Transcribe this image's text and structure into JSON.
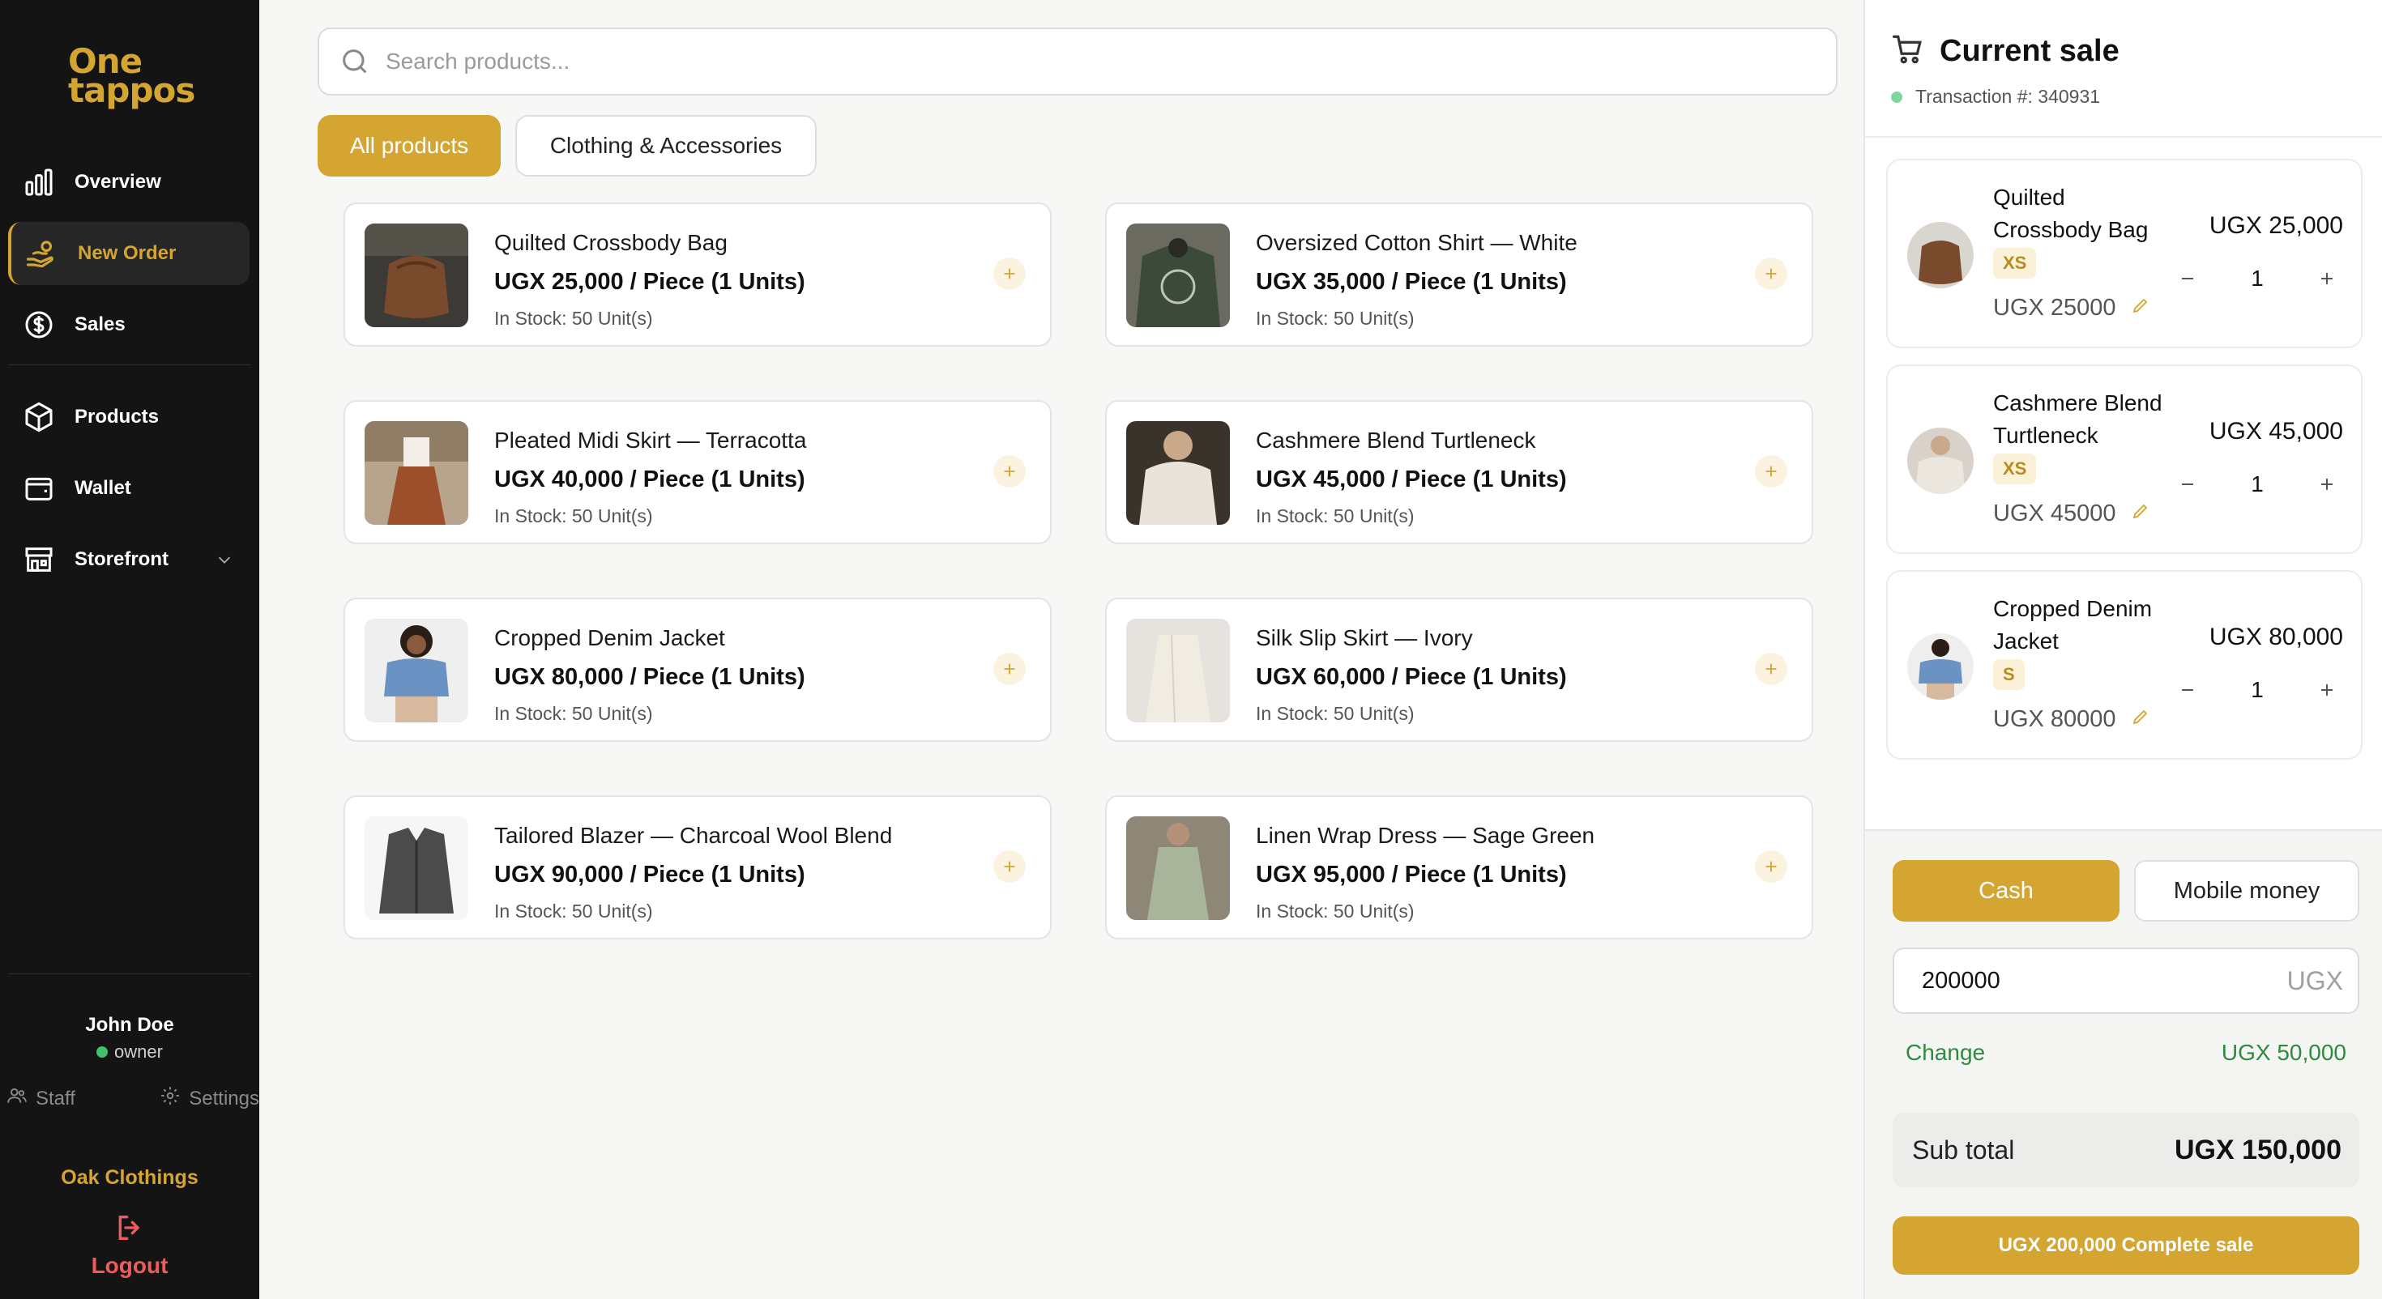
{
  "brand": {
    "logo_line1": "One",
    "logo_line2": "tappos",
    "accent": "#d4a531"
  },
  "sidebar": {
    "items": [
      {
        "label": "Overview",
        "icon": "bar-chart-icon"
      },
      {
        "label": "New Order",
        "icon": "hand-coins-icon",
        "active": true
      },
      {
        "label": "Sales",
        "icon": "dollar-circle-icon"
      },
      {
        "label": "Products",
        "icon": "box-icon"
      },
      {
        "label": "Wallet",
        "icon": "wallet-icon"
      },
      {
        "label": "Storefront",
        "icon": "store-icon"
      }
    ],
    "user": {
      "name": "John Doe",
      "role": "owner"
    },
    "staff_label": "Staff",
    "settings_label": "Settings",
    "store_name": "Oak Clothings",
    "logout_label": "Logout"
  },
  "search": {
    "placeholder": "Search products..."
  },
  "tabs": [
    {
      "label": "All products",
      "active": true
    },
    {
      "label": "Clothing & Accessories",
      "active": false
    }
  ],
  "products": [
    {
      "title": "Quilted Crossbody Bag",
      "price": "UGX 25,000 / Piece (1 Units)",
      "stock": "In Stock: 50 Unit(s)"
    },
    {
      "title": "Oversized Cotton Shirt — White",
      "price": "UGX 35,000 / Piece (1 Units)",
      "stock": "In Stock: 50 Unit(s)"
    },
    {
      "title": "Pleated Midi Skirt — Terracotta",
      "price": "UGX 40,000 / Piece (1 Units)",
      "stock": "In Stock: 50 Unit(s)"
    },
    {
      "title": "Cashmere Blend Turtleneck",
      "price": "UGX 45,000 / Piece (1 Units)",
      "stock": "In Stock: 50 Unit(s)"
    },
    {
      "title": "Cropped Denim Jacket",
      "price": "UGX 80,000 / Piece (1 Units)",
      "stock": "In Stock: 50 Unit(s)"
    },
    {
      "title": "Silk Slip Skirt — Ivory",
      "price": "UGX 60,000 / Piece (1 Units)",
      "stock": "In Stock: 50 Unit(s)"
    },
    {
      "title": "Tailored Blazer — Charcoal Wool Blend",
      "price": "UGX 90,000 / Piece (1 Units)",
      "stock": "In Stock: 50 Unit(s)"
    },
    {
      "title": "Linen Wrap Dress — Sage Green",
      "price": "UGX 95,000 / Piece (1 Units)",
      "stock": "In Stock: 50 Unit(s)"
    }
  ],
  "sale": {
    "title": "Current sale",
    "transaction": "Transaction #: 340931",
    "items": [
      {
        "name": "Quilted Crossbody Bag",
        "size": "XS",
        "unit_price": "UGX 25000",
        "line_price": "UGX 25,000",
        "qty": "1"
      },
      {
        "name": "Cashmere Blend Turtleneck",
        "size": "XS",
        "unit_price": "UGX 45000",
        "line_price": "UGX 45,000",
        "qty": "1"
      },
      {
        "name": "Cropped Denim Jacket",
        "size": "S",
        "unit_price": "UGX 80000",
        "line_price": "UGX 80,000",
        "qty": "1"
      }
    ],
    "payment_methods": [
      {
        "label": "Cash",
        "active": true
      },
      {
        "label": "Mobile money",
        "active": false
      }
    ],
    "amount_value": "200000",
    "amount_currency": "UGX",
    "change_label": "Change",
    "change_value": "UGX 50,000",
    "subtotal_label": "Sub total",
    "subtotal_value": "UGX 150,000",
    "complete_label": "UGX 200,000 Complete sale"
  }
}
